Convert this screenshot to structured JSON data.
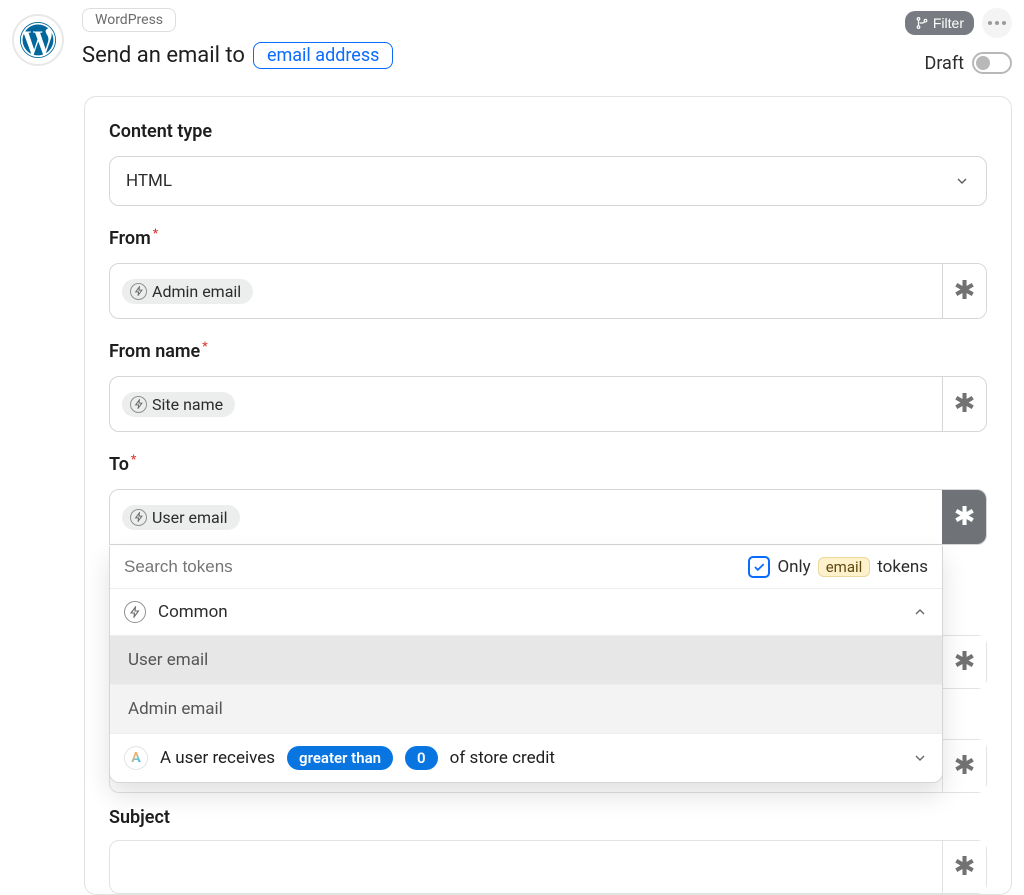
{
  "header": {
    "app_tag": "WordPress",
    "title_prefix": "Send an email to",
    "title_chip": "email address",
    "filter_label": "Filter",
    "draft_label": "Draft"
  },
  "fields": {
    "content_type": {
      "label": "Content type",
      "value": "HTML"
    },
    "from": {
      "label": "From",
      "token": "Admin email"
    },
    "from_name": {
      "label": "From name",
      "token": "Site name"
    },
    "to": {
      "label": "To",
      "token": "User email"
    },
    "subject_label": "Subject"
  },
  "dropdown": {
    "search_placeholder": "Search tokens",
    "only_label": "Only",
    "only_chip": "email",
    "only_suffix": "tokens",
    "group": "Common",
    "items": [
      "User email",
      "Admin email"
    ],
    "trigger": {
      "prefix": "A user receives",
      "comparator": "greater than",
      "amount": "0",
      "suffix": "of store credit"
    }
  }
}
